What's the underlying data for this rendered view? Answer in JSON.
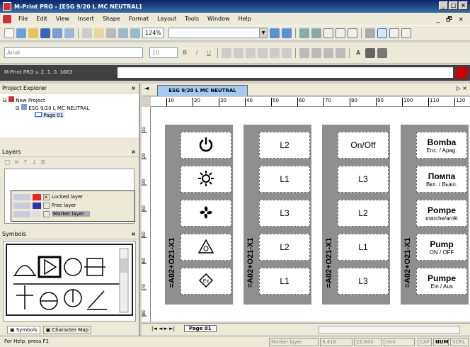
{
  "window": {
    "title": "M-Print PRO - [ESG 9/20 L MC NEUTRAL]",
    "min": "_",
    "max": "□",
    "close": "×"
  },
  "menu": [
    "File",
    "Edit",
    "View",
    "Insert",
    "Shape",
    "Format",
    "Layout",
    "Tools",
    "Window",
    "Help"
  ],
  "mdi_controls": "_ 🗗 ×",
  "toolbar": {
    "zoom": "124%",
    "font": "Arial",
    "font_size": "10"
  },
  "version": "M-Print PRO v. 2. 1. 0. 1663",
  "project_explorer": {
    "title": "Project Explorer",
    "root": "New Project",
    "doc": "ESG 9/20 L MC NEUTRAL",
    "page": "Page 01"
  },
  "layers": {
    "title": "Layers",
    "items": [
      "Locked layer",
      "Free layer",
      "Marker layer"
    ]
  },
  "symbols": {
    "title": "Symbols"
  },
  "bottom_tabs": {
    "symbols": "Symbols",
    "charmap": "Character Map"
  },
  "doc_tab": "ESG 9/20 L MC NEUTRAL",
  "page_tab": "Page 01",
  "strip_id": "=A02+O21-X1",
  "strips": [
    {
      "labels": [
        {
          "icon": "power-icon"
        },
        {
          "icon": "sun-icon"
        },
        {
          "icon": "fan-icon"
        },
        {
          "icon": "hazard-icon"
        },
        {
          "icon": "ex-icon",
          "text": "Ex"
        }
      ]
    },
    {
      "labels": [
        {
          "text": "L2"
        },
        {
          "text": "L1"
        },
        {
          "text": "L3"
        },
        {
          "text": "L2"
        },
        {
          "text": "L1"
        }
      ]
    },
    {
      "labels": [
        {
          "text": "On/Off"
        },
        {
          "text": "L3"
        },
        {
          "text": "L2"
        },
        {
          "text": "L1"
        },
        {
          "text": "L3"
        }
      ]
    },
    {
      "labels": [
        {
          "big": "Bomba",
          "small": "Enc. / Apag."
        },
        {
          "big": "Помпа",
          "small": "Вкл. / Выкл."
        },
        {
          "big": "Pompe",
          "small": "marche/arrêt"
        },
        {
          "big": "Pump",
          "small": "ON / OFF"
        },
        {
          "big": "Pumpe",
          "small": "Ein / Aus"
        }
      ]
    }
  ],
  "ruler_marks": [
    "10",
    "20",
    "30",
    "40",
    "50",
    "60",
    "70",
    "80",
    "90",
    "100",
    "110",
    "120"
  ],
  "vruler_marks": [
    "10",
    "20",
    "30",
    "40",
    "50",
    "60",
    "70",
    "80"
  ],
  "status": {
    "help": "For Help, press F1",
    "layer": "Marker layer",
    "x": "9,416",
    "y": "22,843",
    "unit": "mm",
    "caps": "CAP",
    "num": "NUM",
    "scrl": "SCRL"
  }
}
